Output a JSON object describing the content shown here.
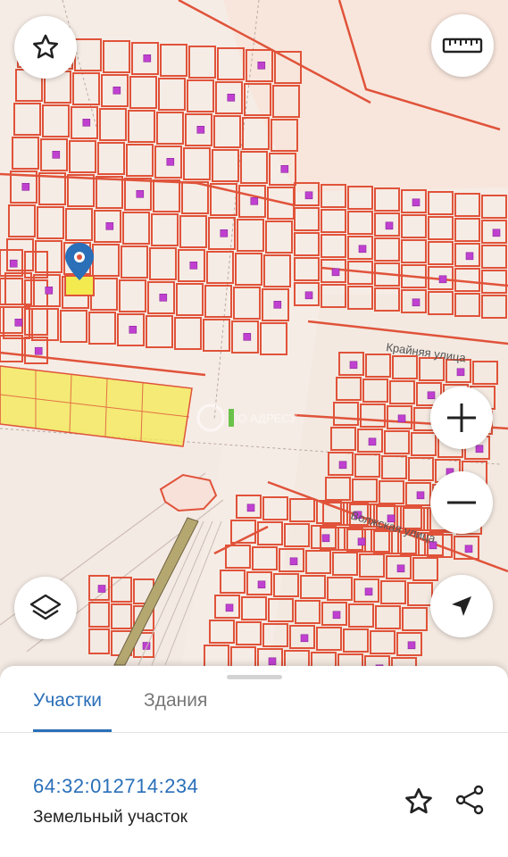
{
  "map": {
    "streets": [
      "Крайняя улица",
      "Волжская улица"
    ],
    "watermark": "ПО АДРЕСУ",
    "colors": {
      "background": "#f6ece6",
      "parcel_stroke": "#e0533a",
      "selected_parcel": "#f3ea4f",
      "building": "#c040d0",
      "pin": "#2a6fb8"
    }
  },
  "controls": {
    "favorite": "star-icon",
    "ruler": "ruler-icon",
    "zoom_in": "plus-icon",
    "zoom_out": "minus-icon",
    "layers": "layers-icon",
    "locate": "navigation-arrow-icon"
  },
  "sheet": {
    "tabs": [
      {
        "label": "Участки",
        "active": true
      },
      {
        "label": "Здания",
        "active": false
      }
    ],
    "parcel": {
      "cadastral_number": "64:32:012714:234",
      "type": "Земельный участок"
    },
    "actions": {
      "favorite": "star-outline-icon",
      "share": "share-icon"
    }
  }
}
